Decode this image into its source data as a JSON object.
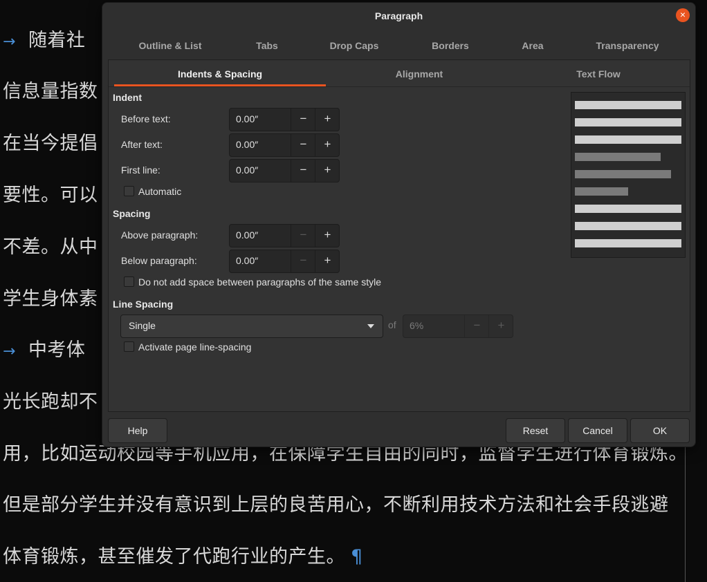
{
  "document": {
    "lines": [
      "随着社",
      "信息量指数",
      "在当今提倡",
      "要性。可以",
      "不差。从中",
      "学生身体素",
      "中考体",
      "光长跑却不",
      "用，比如运动校园等手机应用，在保障学生自由的同时，监督学生进行体育锻炼。",
      "但是部分学生并没有意识到上层的良苦用心，不断利用技术方法和社会手段逃避",
      "体育锻炼，甚至催发了代跑行业的产生。"
    ],
    "arrow": "→",
    "pilcrow": "¶"
  },
  "dialog": {
    "title": "Paragraph",
    "close_icon": "×",
    "tabs_row1": [
      "Outline & List",
      "Tabs",
      "Drop Caps",
      "Borders",
      "Area",
      "Transparency"
    ],
    "tabs_row2": [
      "Indents & Spacing",
      "Alignment",
      "Text Flow"
    ],
    "active_tab": "Indents & Spacing",
    "indent": {
      "heading": "Indent",
      "before_label": "Before text:",
      "before_value": "0.00″",
      "after_label": "After text:",
      "after_value": "0.00″",
      "first_label": "First line:",
      "first_value": "0.00″",
      "automatic_label": "Automatic"
    },
    "spacing": {
      "heading": "Spacing",
      "above_label": "Above paragraph:",
      "above_value": "0.00″",
      "below_label": "Below paragraph:",
      "below_value": "0.00″",
      "no_space_label": "Do not add space between paragraphs of the same style"
    },
    "line_spacing": {
      "heading": "Line Spacing",
      "selected": "Single",
      "of_label": "of",
      "value": "6%",
      "activate_label": "Activate page line-spacing"
    },
    "stepper": {
      "minus": "−",
      "plus": "+"
    },
    "buttons": {
      "help": "Help",
      "reset": "Reset",
      "cancel": "Cancel",
      "ok": "OK"
    },
    "colors": {
      "accent": "#e95420",
      "preview_light": "#cfcfcf",
      "preview_dark": "#7a7a7a"
    }
  }
}
